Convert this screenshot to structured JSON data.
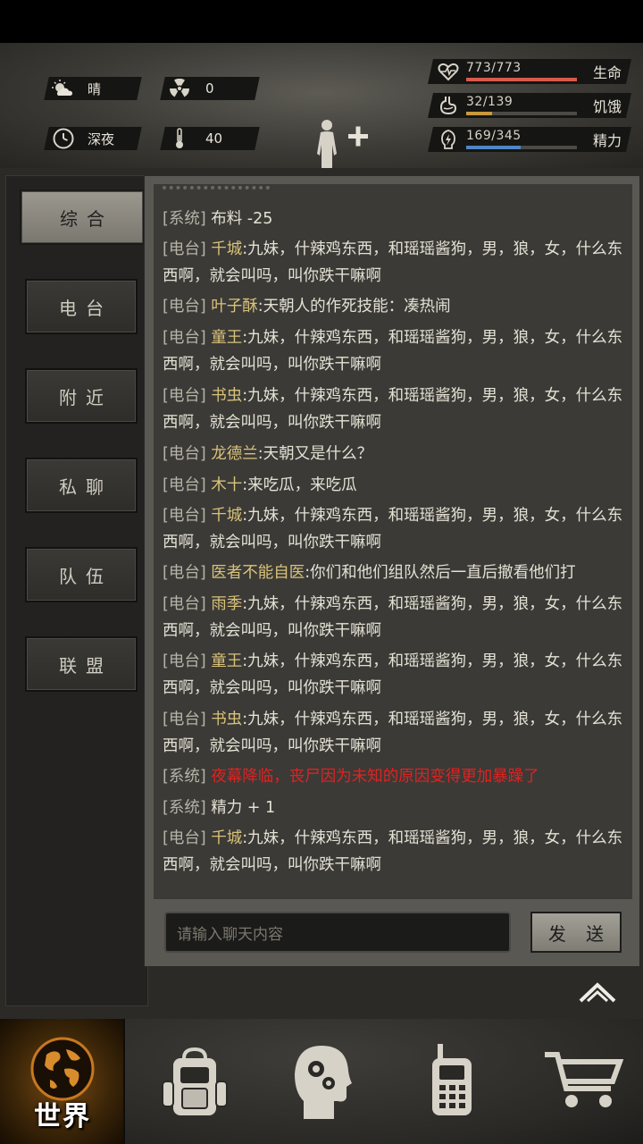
{
  "weather": {
    "condition": "晴",
    "radiation": "0",
    "time_of_day": "深夜",
    "temperature": "40"
  },
  "stats": [
    {
      "icon": "heart-icon",
      "value": "773/773",
      "label": "生命",
      "fraction": 1.0,
      "color": "#d85a4c"
    },
    {
      "icon": "stomach-icon",
      "value": "32/139",
      "label": "饥饿",
      "fraction": 0.23,
      "color": "#c89a3c"
    },
    {
      "icon": "energy-icon",
      "value": "169/345",
      "label": "精力",
      "fraction": 0.49,
      "color": "#4e86c6"
    }
  ],
  "tabs": [
    {
      "label": "综合",
      "active": true
    },
    {
      "label": "电台",
      "active": false
    },
    {
      "label": "附近",
      "active": false
    },
    {
      "label": "私聊",
      "active": false
    },
    {
      "label": "队伍",
      "active": false
    },
    {
      "label": "联盟",
      "active": false
    }
  ],
  "messages": [
    {
      "tag": "[系统]",
      "name": "",
      "text": "布料 -25",
      "style": "sys"
    },
    {
      "tag": "[电台]",
      "name": "千城",
      "text": ":九妹，什辣鸡东西，和瑶瑶酱狗，男，狼，女，什么东西啊，就会叫吗，叫你跌干嘛啊",
      "style": "radio"
    },
    {
      "tag": "[电台]",
      "name": "叶子酥",
      "text": ":天朝人的作死技能：凑热闹",
      "style": "radio"
    },
    {
      "tag": "[电台]",
      "name": "童王",
      "text": ":九妹，什辣鸡东西，和瑶瑶酱狗，男，狼，女，什么东西啊，就会叫吗，叫你跌干嘛啊",
      "style": "radio"
    },
    {
      "tag": "[电台]",
      "name": "书虫",
      "text": ":九妹，什辣鸡东西，和瑶瑶酱狗，男，狼，女，什么东西啊，就会叫吗，叫你跌干嘛啊",
      "style": "radio"
    },
    {
      "tag": "[电台]",
      "name": "龙德兰",
      "text": ":天朝又是什么？",
      "style": "radio"
    },
    {
      "tag": "[电台]",
      "name": "木十",
      "text": ":来吃瓜，来吃瓜",
      "style": "radio"
    },
    {
      "tag": "[电台]",
      "name": "千城",
      "text": ":九妹，什辣鸡东西，和瑶瑶酱狗，男，狼，女，什么东西啊，就会叫吗，叫你跌干嘛啊",
      "style": "radio"
    },
    {
      "tag": "[电台]",
      "name": "医者不能自医",
      "text": ":你们和他们组队然后一直后撤看他们打",
      "style": "radio"
    },
    {
      "tag": "[电台]",
      "name": "雨季",
      "text": ":九妹，什辣鸡东西，和瑶瑶酱狗，男，狼，女，什么东西啊，就会叫吗，叫你跌干嘛啊",
      "style": "radio"
    },
    {
      "tag": "[电台]",
      "name": "童王",
      "text": ":九妹，什辣鸡东西，和瑶瑶酱狗，男，狼，女，什么东西啊，就会叫吗，叫你跌干嘛啊",
      "style": "radio"
    },
    {
      "tag": "[电台]",
      "name": "书虫",
      "text": ":九妹，什辣鸡东西，和瑶瑶酱狗，男，狼，女，什么东西啊，就会叫吗，叫你跌干嘛啊",
      "style": "radio"
    },
    {
      "tag": "[系统]",
      "name": "",
      "text": "夜幕降临，丧尸因为未知的原因变得更加暴躁了",
      "style": "sys-red"
    },
    {
      "tag": "[系统]",
      "name": "",
      "text": "精力 + 1",
      "style": "sys"
    },
    {
      "tag": "[电台]",
      "name": "千城",
      "text": ":九妹，什辣鸡东西，和瑶瑶酱狗，男，狼，女，什么东西啊，就会叫吗，叫你跌干嘛啊",
      "style": "radio"
    }
  ],
  "chat_input": {
    "placeholder": "请输入聊天内容"
  },
  "send_label": "发 送",
  "nav": {
    "world_label": "世界",
    "items": [
      "globe-icon",
      "backpack-icon",
      "skills-head-icon",
      "radio-icon",
      "cart-icon"
    ]
  }
}
